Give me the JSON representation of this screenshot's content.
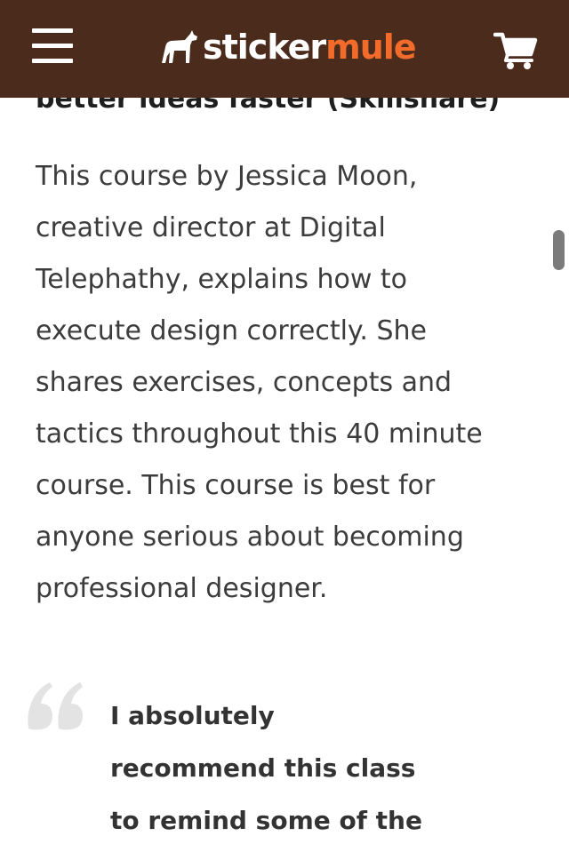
{
  "header": {
    "logo_part1": "sticker",
    "logo_part2": "mule",
    "menu_icon": "hamburger-menu-icon",
    "logo_icon": "mule-logo-icon",
    "cart_icon": "shopping-cart-icon",
    "background_color": "#4a2b1c",
    "accent_color": "#f26b2b"
  },
  "article": {
    "heading": "better ideas faster (Skillshare)",
    "paragraph_lines": [
      "This course by Jessica Moon,",
      "creative director at Digital",
      "Telephathy, explains how to",
      "execute design correctly. She",
      "shares exercises, concepts and",
      "tactics throughout this 40 minute",
      "course. This course is best for",
      "anyone serious about becoming",
      "professional designer."
    ]
  },
  "quote": {
    "icon": "quote-mark-icon",
    "lines": [
      "I absolutely",
      "recommend this class",
      "to remind some of the"
    ]
  }
}
